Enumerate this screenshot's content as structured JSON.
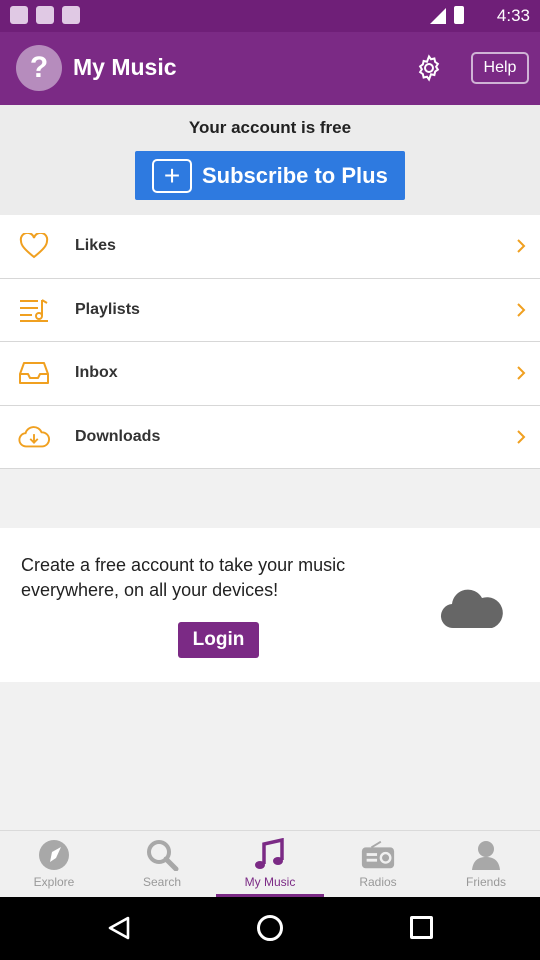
{
  "status_bar": {
    "time": "4:33"
  },
  "app_bar": {
    "avatar_glyph": "?",
    "title": "My Music",
    "settings_icon": "gear-icon",
    "help_label": "Help"
  },
  "account": {
    "status_text": "Your account is free",
    "subscribe_label": "Subscribe to Plus"
  },
  "menu": {
    "items": [
      {
        "label": "Likes",
        "icon": "heart-icon"
      },
      {
        "label": "Playlists",
        "icon": "playlist-icon"
      },
      {
        "label": "Inbox",
        "icon": "inbox-icon"
      },
      {
        "label": "Downloads",
        "icon": "cloud-download-icon"
      }
    ]
  },
  "promo": {
    "text": "Create a free account to take your music everywhere, on all your devices!",
    "login_label": "Login"
  },
  "bottom_nav": {
    "tabs": [
      {
        "label": "Explore",
        "icon": "compass-icon",
        "active": false
      },
      {
        "label": "Search",
        "icon": "search-icon",
        "active": false
      },
      {
        "label": "My Music",
        "icon": "music-note-icon",
        "active": true
      },
      {
        "label": "Radios",
        "icon": "radio-icon",
        "active": false
      },
      {
        "label": "Friends",
        "icon": "person-icon",
        "active": false
      }
    ]
  },
  "colors": {
    "brand_purple": "#7b2a85",
    "subscribe_blue": "#2e7ae0",
    "accent_orange": "#f0a020"
  }
}
